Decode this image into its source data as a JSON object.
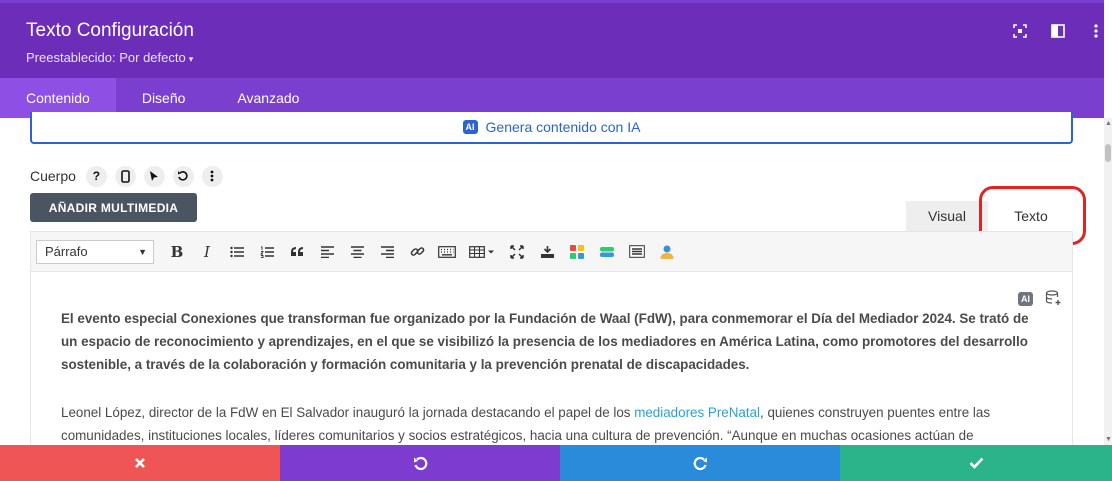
{
  "header": {
    "title": "Texto Configuración",
    "preset": "Preestablecido: Por defecto",
    "preset_caret": "▾",
    "icons": [
      "focus-icon",
      "split-view-icon",
      "more-vertical-icon"
    ]
  },
  "tabs": [
    {
      "label": "Contenido",
      "active": true
    },
    {
      "label": "Diseño",
      "active": false
    },
    {
      "label": "Avanzado",
      "active": false
    }
  ],
  "ai_generate": {
    "badge": "AI",
    "label": "Genera contenido con IA"
  },
  "body_field": {
    "label": "Cuerpo"
  },
  "add_media": "AÑADIR MULTIMEDIA",
  "editor_modes": {
    "visual": "Visual",
    "text": "Texto"
  },
  "toolbar": {
    "format": "Párrafo"
  },
  "editor_tools": {
    "ai_badge": "AI"
  },
  "content": {
    "p1": "El evento especial Conexiones que transforman fue organizado por la Fundación de Waal (FdW), para conmemorar el Día del Mediador 2024. Se trató de un espacio de reconocimiento y aprendizajes, en el que se visibilizó la presencia de los mediadores en América Latina, como promotores del desarrollo sostenible, a través de la colaboración y formación comunitaria y la prevención prenatal de discapacidades.",
    "p2_before": "Leonel López, director de la FdW en El Salvador inauguró la jornada destacando el papel de los ",
    "p2_link": "mediadores PreNatal",
    "p2_after": ", quienes construyen puentes  entre las comunidades, instituciones locales, líderes comunitarios y socios estratégicos, hacia una cultura de prevención. “Aunque en muchas ocasiones actúan de"
  },
  "colors": {
    "header": "#6c2eb9",
    "tabs": "#7b3fd0",
    "cancel": "#ef5555",
    "undo": "#7d3bd0",
    "redo": "#2a8bdb",
    "save": "#2bb38a",
    "highlight": "#e32222",
    "link": "#2e9fd6"
  }
}
